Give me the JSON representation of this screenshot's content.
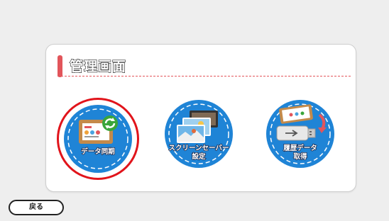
{
  "panel": {
    "title": "管理画面",
    "accent_color": "#e2555b"
  },
  "buttons": [
    {
      "label": "データ同期",
      "icon": "sync-screen-icon",
      "selected": true
    },
    {
      "label_line1": "スクリーンセーバー",
      "label_line2": "設定",
      "icon": "screensaver-photos-icon"
    },
    {
      "label_line1": "履歴データ",
      "label_line2": "取得",
      "icon": "usb-download-icon"
    }
  ],
  "back_button": {
    "label": "戻る"
  },
  "colors": {
    "button_blue": "#1f84d6",
    "selection_ring": "#e1141b",
    "background": "#eeeeee"
  }
}
